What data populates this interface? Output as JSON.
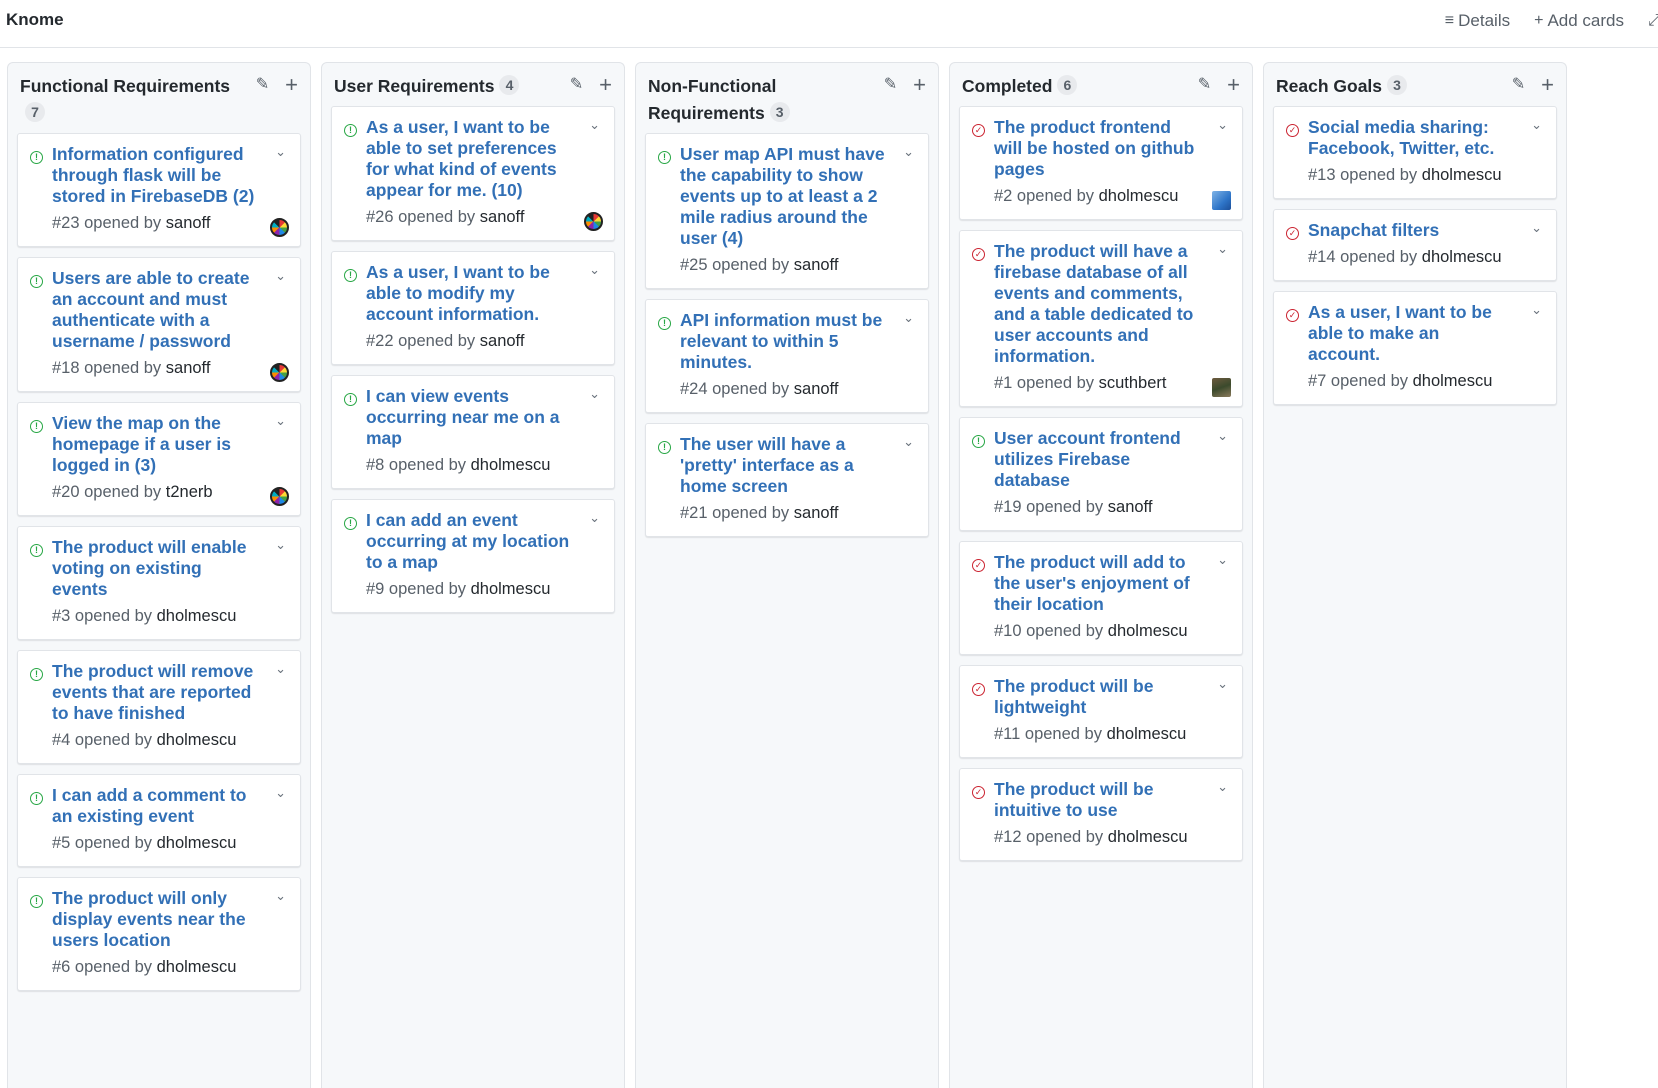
{
  "project": {
    "name": "Knome"
  },
  "toolbar": {
    "details_label": "Details",
    "add_cards_label": "Add cards"
  },
  "colors": {
    "link_blue": "#3270b6",
    "open_green": "#28a745",
    "closed_red": "#cb2431"
  },
  "columns": [
    {
      "title": "Functional Requirements",
      "count": "7",
      "cards": [
        {
          "title": "Information configured through flask will be stored in FirebaseDB (2)",
          "meta": "#23 opened by",
          "author": "sanoff",
          "state": "open",
          "avatar": "ball"
        },
        {
          "title": "Users are able to create an account and must authenticate with a username / password",
          "meta": "#18 opened by",
          "author": "sanoff",
          "state": "open",
          "avatar": "ball"
        },
        {
          "title": "View the map on the homepage if a user is logged in (3)",
          "meta": "#20 opened by",
          "author": "t2nerb",
          "state": "open",
          "avatar": "ball"
        },
        {
          "title": "The product will enable voting on existing events",
          "meta": "#3 opened by",
          "author": "dholmescu",
          "state": "open",
          "avatar": ""
        },
        {
          "title": "The product will remove events that are reported to have finished",
          "meta": "#4 opened by",
          "author": "dholmescu",
          "state": "open",
          "avatar": ""
        },
        {
          "title": "I can add a comment to an existing event",
          "meta": "#5 opened by",
          "author": "dholmescu",
          "state": "open",
          "avatar": ""
        },
        {
          "title": "The product will only display events near the users location",
          "meta": "#6 opened by",
          "author": "dholmescu",
          "state": "open",
          "avatar": ""
        }
      ]
    },
    {
      "title": "User Requirements",
      "count": "4",
      "cards": [
        {
          "title": "As a user, I want to be able to set preferences for what kind of events appear for me. (10)",
          "meta": "#26 opened by",
          "author": "sanoff",
          "state": "open",
          "avatar": "ball"
        },
        {
          "title": "As a user, I want to be able to modify my account information.",
          "meta": "#22 opened by",
          "author": "sanoff",
          "state": "open",
          "avatar": ""
        },
        {
          "title": "I can view events occurring near me on a map",
          "meta": "#8 opened by",
          "author": "dholmescu",
          "state": "open",
          "avatar": ""
        },
        {
          "title": "I can add an event occurring at my location to a map",
          "meta": "#9 opened by",
          "author": "dholmescu",
          "state": "open",
          "avatar": ""
        }
      ]
    },
    {
      "title": "Non-Functional Requirements",
      "count": "3",
      "cards": [
        {
          "title": "User map API must have the capability to show events up to at least a 2 mile radius around the user (4)",
          "meta": "#25 opened by",
          "author": "sanoff",
          "state": "open",
          "avatar": ""
        },
        {
          "title": "API information must be relevant to within 5 minutes.",
          "meta": "#24 opened by",
          "author": "sanoff",
          "state": "open",
          "avatar": ""
        },
        {
          "title": "The user will have a 'pretty' interface as a home screen",
          "meta": "#21 opened by",
          "author": "sanoff",
          "state": "open",
          "avatar": ""
        }
      ]
    },
    {
      "title": "Completed",
      "count": "6",
      "cards": [
        {
          "title": "The product frontend will be hosted on github pages",
          "meta": "#2 opened by",
          "author": "dholmescu",
          "state": "closed",
          "avatar": "blue"
        },
        {
          "title": "The product will have a firebase database of all events and comments, and a table dedicated to user accounts and information.",
          "meta": "#1 opened by",
          "author": "scuthbert",
          "state": "closed",
          "avatar": "photo"
        },
        {
          "title": "User account frontend utilizes Firebase database",
          "meta": "#19 opened by",
          "author": "sanoff",
          "state": "open",
          "avatar": ""
        },
        {
          "title": "The product will add to the user's enjoyment of their location",
          "meta": "#10 opened by",
          "author": "dholmescu",
          "state": "closed",
          "avatar": ""
        },
        {
          "title": "The product will be lightweight",
          "meta": "#11 opened by",
          "author": "dholmescu",
          "state": "closed",
          "avatar": ""
        },
        {
          "title": "The product will be intuitive to use",
          "meta": "#12 opened by",
          "author": "dholmescu",
          "state": "closed",
          "avatar": ""
        }
      ]
    },
    {
      "title": "Reach Goals",
      "count": "3",
      "cards": [
        {
          "title": "Social media sharing: Facebook, Twitter, etc.",
          "meta": "#13 opened by",
          "author": "dholmescu",
          "state": "closed",
          "avatar": ""
        },
        {
          "title": "Snapchat filters",
          "meta": "#14 opened by",
          "author": "dholmescu",
          "state": "closed",
          "avatar": ""
        },
        {
          "title": "As a user, I want to be able to make an account.",
          "meta": "#7 opened by",
          "author": "dholmescu",
          "state": "closed",
          "avatar": ""
        }
      ]
    }
  ]
}
